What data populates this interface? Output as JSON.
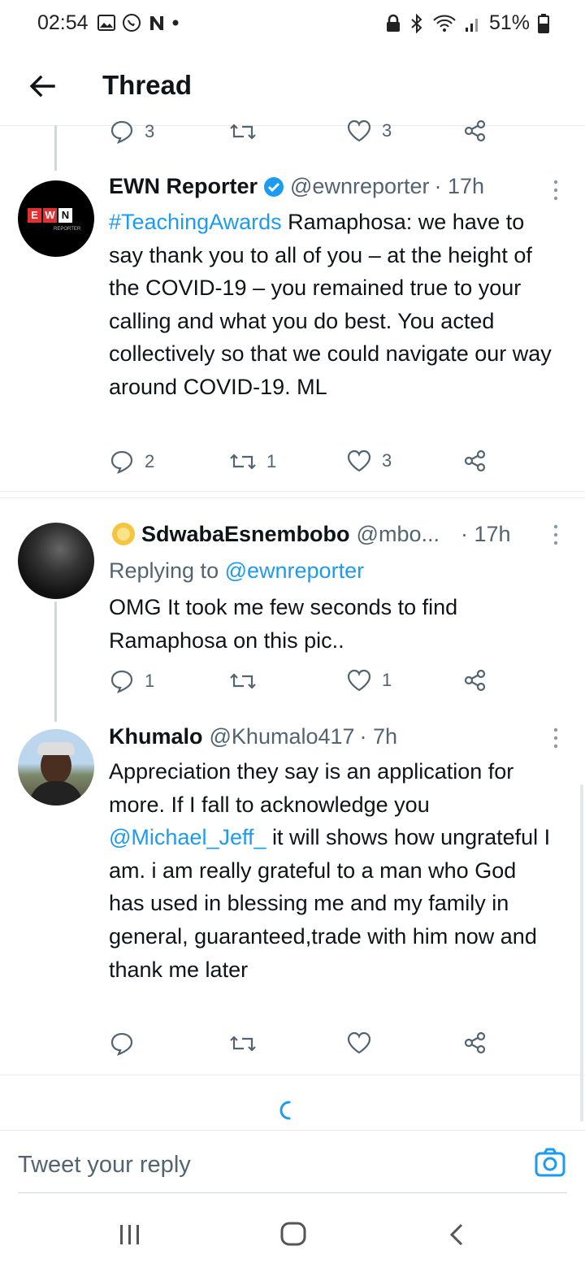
{
  "status_bar": {
    "time": "02:54",
    "battery": "51%"
  },
  "header": {
    "title": "Thread"
  },
  "prev_actions": {
    "replies": "3",
    "retweets": "",
    "likes": "3"
  },
  "tweets": [
    {
      "name": "EWN Reporter",
      "handle": "@ewnreporter",
      "time": "· 17h",
      "verified": true,
      "hashtag": "#TeachingAwards",
      "text": " Ramaphosa: we have to say thank you to all of you – at the height of the COVID-19 – you remained true to your calling and what you do best. You acted collectively so that we could navigate our way around COVID-19. ML",
      "replies": "2",
      "retweets": "1",
      "likes": "3"
    },
    {
      "name": "SdwabaEsnembobo",
      "handle": "@mbo...",
      "time": "· 17h",
      "replying_prefix": "Replying to ",
      "replying_handle": "@ewnreporter",
      "text": "OMG It took me few seconds to find Ramaphosa on this pic..",
      "replies": "1",
      "retweets": "",
      "likes": "1"
    },
    {
      "name": "Khumalo",
      "handle": "@Khumalo417",
      "time": "· 7h",
      "text_a": "Appreciation they say is an application for more. If I fall to acknowledge you ",
      "mention": "@Michael_Jeff_",
      "text_b": " it will shows how ungrateful I am. i am really grateful to a man who God has used in blessing me and my family in general, guaranteed,trade with him now and thank me later",
      "replies": "",
      "retweets": "",
      "likes": ""
    }
  ],
  "reply_box": {
    "placeholder": "Tweet your reply"
  },
  "avatar_logo": {
    "letters": [
      "E",
      "W",
      "N"
    ],
    "sub": "REPORTER"
  },
  "colors": {
    "accent": "#1d9bf0",
    "text": "#0f1419",
    "muted": "#536471"
  }
}
